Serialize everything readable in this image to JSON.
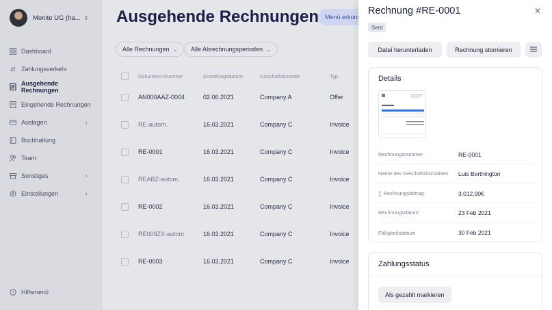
{
  "sidebar": {
    "account_name": "Monite UG (ha...",
    "items": [
      {
        "label": "Dashboard",
        "icon": "grid-icon"
      },
      {
        "label": "Zahlungsverkehr",
        "icon": "transfer-icon"
      },
      {
        "label": "Ausgehende Rechnungen",
        "icon": "invoice-out-icon"
      },
      {
        "label": "Eingehende Rechnungen",
        "icon": "invoice-in-icon"
      },
      {
        "label": "Auslagen",
        "icon": "expenses-icon"
      },
      {
        "label": "Buchhaltung",
        "icon": "ledger-icon"
      },
      {
        "label": "Team",
        "icon": "team-icon"
      },
      {
        "label": "Sonstiges",
        "icon": "misc-icon"
      },
      {
        "label": "Einstellungen",
        "icon": "settings-icon"
      }
    ],
    "help_label": "Hilfsmenü"
  },
  "main": {
    "title": "Ausgehende Rechnungen",
    "menu_pill": "Menü erkund",
    "filters": [
      "Alle Rechnungen",
      "Alle Abrechnungsperioden"
    ],
    "columns": [
      "Dokument-Nummer",
      "Erstellungsdatum",
      "Geschäftskontakt",
      "Typ"
    ],
    "rows": [
      {
        "number": "AN000AAZ-0004",
        "date": "02.06.2021",
        "contact": "Company A",
        "type": "Offer",
        "muted": false
      },
      {
        "number": "RE-autom.",
        "date": "16.03.2021",
        "contact": "Company C",
        "type": "Invoice",
        "muted": true
      },
      {
        "number": "RE-0001",
        "date": "16.03.2021",
        "contact": "Company C",
        "type": "Invoice",
        "muted": false
      },
      {
        "number": "REABZ-autom.",
        "date": "16.03.2021",
        "contact": "Company C",
        "type": "Invoice",
        "muted": true
      },
      {
        "number": "RE-0002",
        "date": "16.03.2021",
        "contact": "Company C",
        "type": "Invoice",
        "muted": false
      },
      {
        "number": "RE009ZX-autom.",
        "date": "16.03.2021",
        "contact": "Company C",
        "type": "Invoice",
        "muted": true
      },
      {
        "number": "RE-0003",
        "date": "16.03.2021",
        "contact": "Company C",
        "type": "Invoice",
        "muted": false
      }
    ]
  },
  "panel": {
    "title": "Rechnung #RE-0001",
    "status_badge": "Sent",
    "download_label": "Datei herunterladen",
    "cancel_label": "Rechnung stornieren",
    "details_title": "Details",
    "details": [
      {
        "key": "Rechnungsnummer",
        "value": "RE-0001"
      },
      {
        "key": "Name des Geschäftskontaktes",
        "value": "Luis Berthington"
      },
      {
        "key": "∑ Rechnungsbetrag",
        "value": "3.012,90€"
      },
      {
        "key": "Rechnungsdatum",
        "value": "23 Feb 2021"
      },
      {
        "key": "Fälligkeitsdatum",
        "value": "30 Feb 2021"
      }
    ],
    "payment_title": "Zahlungsstatus",
    "mark_paid_label": "Als gezahlt markieren"
  },
  "colors": {
    "accent": "#3a55c8",
    "title": "#1b1f4a",
    "sidebar_bg": "#d9dbe0",
    "panel_bg": "#ffffff"
  }
}
